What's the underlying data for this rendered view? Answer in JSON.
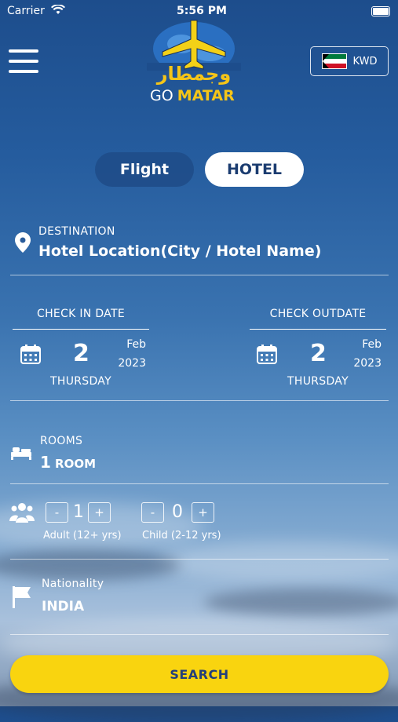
{
  "status_bar": {
    "carrier": "Carrier",
    "time": "5:56 PM"
  },
  "brand": {
    "arabic": "وجمطار",
    "go": "GO",
    "matar": "MATAR"
  },
  "currency": {
    "code": "KWD",
    "flag": "kuwait-flag"
  },
  "tabs": [
    {
      "label": "Flight"
    },
    {
      "label": "HOTEL"
    }
  ],
  "destination": {
    "label": "DESTINATION",
    "value": "Hotel Location(City / Hotel Name)"
  },
  "check_in": {
    "label": "CHECK IN DATE",
    "day": "2",
    "month": "Feb",
    "year": "2023",
    "weekday": "THURSDAY"
  },
  "check_out": {
    "label": "CHECK OUTDATE",
    "day": "2",
    "month": "Feb",
    "year": "2023",
    "weekday": "THURSDAY"
  },
  "rooms": {
    "label": "ROOMS",
    "count": "1",
    "unit": "ROOM"
  },
  "guests": {
    "adult": {
      "value": "1",
      "label": "Adult (12+ yrs)"
    },
    "child": {
      "value": "0",
      "label": "Child (2-12 yrs)"
    },
    "minus": "-",
    "plus": "+"
  },
  "nationality": {
    "label": "Nationality",
    "value": "INDIA"
  },
  "search": {
    "label": "SEARCH"
  },
  "colors": {
    "accent": "#f9d40f",
    "brand_blue": "#1b3c70"
  }
}
